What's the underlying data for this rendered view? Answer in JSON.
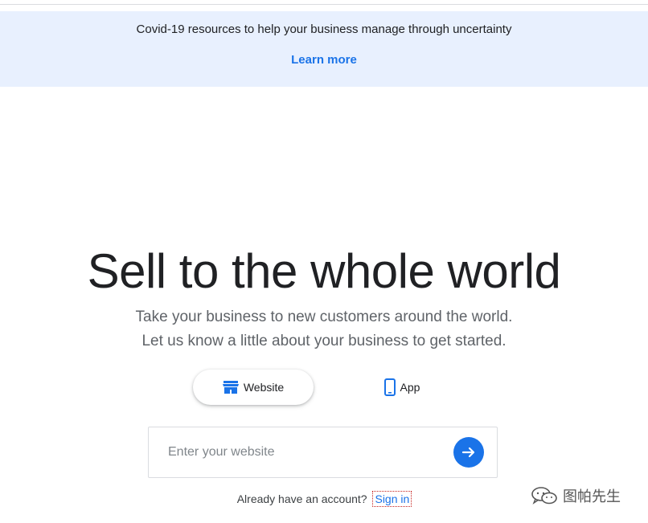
{
  "banner": {
    "message": "Covid-19 resources to help your business manage through uncertainty",
    "link_label": "Learn more"
  },
  "hero": {
    "title": "Sell to the whole world",
    "subtitle_line1": "Take your business to new customers around the world.",
    "subtitle_line2": "Let us know a little about your business to get started."
  },
  "type_toggle": {
    "selected": "Website",
    "options": [
      {
        "label": "Website",
        "icon": "storefront-icon"
      },
      {
        "label": "App",
        "icon": "phone-icon"
      }
    ]
  },
  "website_form": {
    "placeholder": "Enter your website",
    "value": "",
    "submit_icon": "arrow-forward-icon"
  },
  "signin": {
    "prompt": "Already have an account?",
    "link_label": "Sign in"
  },
  "watermark": {
    "text": "图帕先生",
    "icon": "wechat-icon"
  },
  "colors": {
    "accent": "#1a73e8",
    "banner_bg": "#e8f0fe",
    "text_primary": "#202124",
    "text_secondary": "#5f6368"
  }
}
